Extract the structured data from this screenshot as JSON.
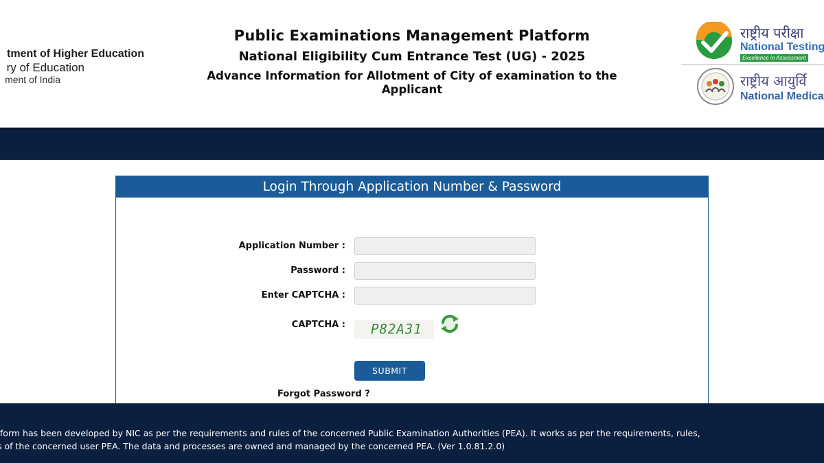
{
  "header": {
    "ministry_line1": "tment of Higher Education",
    "ministry_line2": "ry of Education",
    "ministry_line3": "ment of India",
    "title": "Public Examinations Management Platform",
    "subtitle": "National Eligibility Cum Entrance Test (UG) - 2025",
    "notice": "Advance Information for Allotment of City of examination to the Applicant",
    "nta_hindi": "राष्ट्रीय परीक्षा",
    "nta_english": "National Testing",
    "nta_tagline": "Excellence in Assessment",
    "nmc_hindi": "राष्ट्रीय आयुर्वि",
    "nmc_english": "National Medica"
  },
  "login": {
    "heading": "Login Through Application Number & Password",
    "application_number_label": "Application Number :",
    "application_number_value": "",
    "password_label": "Password :",
    "password_value": "",
    "captcha_input_label": "Enter CAPTCHA :",
    "captcha_input_value": "",
    "captcha_label": "CAPTCHA :",
    "captcha_text": "P82A31",
    "submit_label": "SUBMIT",
    "forgot_label": "Forgot Password ?"
  },
  "footer": {
    "line1": "tform has been developed by NIC as per the requirements and rules of the concerned Public Examination Authorities (PEA). It works as per the requirements, rules,",
    "line2": "s of the concerned user PEA. The data and processes are owned and managed by the concerned PEA. (Ver 1.0.81.2.0)"
  },
  "colors": {
    "navy": "#0b1f3f",
    "panel_blue": "#1a5c9a",
    "captcha_green": "#2f8a2f"
  },
  "icons": {
    "refresh": "refresh-captcha-icon",
    "nta_logo": "nta-logo",
    "nmc_logo": "nmc-logo"
  }
}
